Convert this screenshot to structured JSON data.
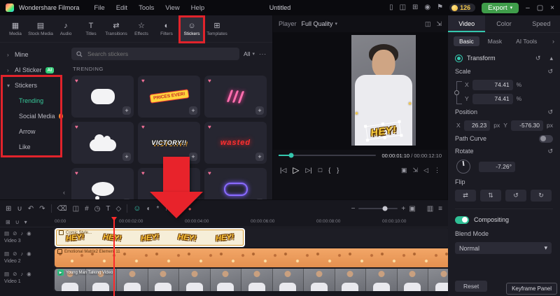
{
  "titlebar": {
    "app_name": "Wondershare Filmora",
    "menus": [
      "File",
      "Edit",
      "Tools",
      "View",
      "Help"
    ],
    "project_title": "Untitled",
    "coin_count": "126",
    "export_label": "Export"
  },
  "library": {
    "tabs": [
      {
        "label": "Media",
        "glyph": "▦"
      },
      {
        "label": "Stock Media",
        "glyph": "▤"
      },
      {
        "label": "Audio",
        "glyph": "♪"
      },
      {
        "label": "Titles",
        "glyph": "T"
      },
      {
        "label": "Transitions",
        "glyph": "⇄"
      },
      {
        "label": "Effects",
        "glyph": "☆"
      },
      {
        "label": "Filters",
        "glyph": "◐"
      },
      {
        "label": "Stickers",
        "glyph": "☺"
      },
      {
        "label": "Templates",
        "glyph": "⊞"
      }
    ],
    "search_placeholder": "Search stickers",
    "filter_label": "All",
    "section_title": "TRENDING",
    "sidebar": {
      "mine": "Mine",
      "ai_sticker": "AI Sticker",
      "ai_badge": "AI",
      "stickers": "Stickers",
      "children": [
        "Trending",
        "Social Media",
        "Arrow",
        "Like"
      ]
    },
    "tiles": {
      "prices_text": "PRICES EVER!",
      "victory_text": "VICTORY!!",
      "wasted_text": "wasted"
    }
  },
  "player": {
    "label": "Player",
    "quality": "Full Quality",
    "time_current": "00:00:01:10",
    "time_separator": "/",
    "time_total": "00:00:12:10",
    "overlay_text": "HEY!"
  },
  "inspector": {
    "tabs": [
      "Video",
      "Color",
      "Speed"
    ],
    "subtabs": [
      "Basic",
      "Mask",
      "AI Tools"
    ],
    "transform_label": "Transform",
    "scale_label": "Scale",
    "axis_x": "X",
    "axis_y": "Y",
    "scale_x": "74.41",
    "scale_y": "74.41",
    "unit_percent": "%",
    "position_label": "Position",
    "pos_x": "26.23",
    "pos_y": "-576.30",
    "unit_px": "px",
    "path_curve_label": "Path Curve",
    "rotate_label": "Rotate",
    "rotate_value": "-7.26°",
    "flip_label": "Flip",
    "compositing_label": "Compositing",
    "blend_mode_label": "Blend Mode",
    "blend_value": "Normal",
    "reset_label": "Reset",
    "keyframe_panel_label": "Keyframe Panel"
  },
  "timeline": {
    "ruler": [
      "00:00",
      "00:00:02:00",
      "00:00:04:00",
      "00:00:06:00",
      "00:00:08:00",
      "00:00:10:00"
    ],
    "tracks": [
      {
        "name": "Video 3",
        "clip_label": "Comic Style...",
        "sticker_text": "HEY!"
      },
      {
        "name": "Video 2",
        "clip_label": "Emotional Matrix2 Element 11"
      },
      {
        "name": "Video 1",
        "clip_label": "Young Man Talking Video"
      }
    ]
  }
}
